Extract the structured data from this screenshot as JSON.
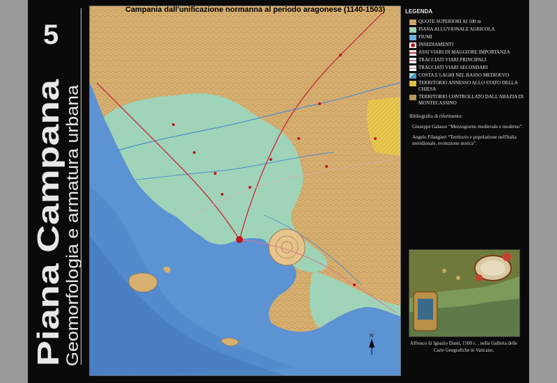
{
  "series_number": "5",
  "series_title": "Piana Campana",
  "series_subtitle": "Geomorfologia e armatura urbana",
  "map": {
    "title": "Campania dall'unificazione normanna al periodo aragonese (1140-1503)",
    "north_label": "N"
  },
  "legend": {
    "title": "LEGENDA",
    "items": [
      {
        "label": "QUOTE SUPERIORI AI 100 m",
        "color": "#d8b070",
        "icon": "hatched-swatch"
      },
      {
        "label": "PIANA ALLUVIONALE AGRICOLA",
        "color": "#9fd4b8",
        "icon": "solid-swatch"
      },
      {
        "label": "FIUMI",
        "color": "#6aaee0",
        "icon": "river-swatch"
      },
      {
        "label": "INSEDIAMENTI",
        "color": "#c0141c",
        "icon": "settlement-marker"
      },
      {
        "label": "ASSI VIARI DI MAGGIORE IMPORTANZA",
        "color": "#c83040",
        "icon": "road-major"
      },
      {
        "label": "TRACCIATI VIARI PRINCIPALI",
        "color": "#d87890",
        "icon": "road-main"
      },
      {
        "label": "TRACCIATI VIARI SECONDARI",
        "color": "#e0a8b8",
        "icon": "road-secondary"
      },
      {
        "label": "COSTA E LAGHI NEL BASSO MEDIOEVO",
        "color": "#3a8cc8",
        "icon": "coast-swatch"
      },
      {
        "label": "TERRITORIO ANNESSO ALLO STATO DELLA CHIESA",
        "color": "#e8c850",
        "icon": "hatched-yellow"
      },
      {
        "label": "TERRITORIO CONTROLLATO DALL'ABAZIA DI MONTECASSINO",
        "color": "#c8a860",
        "icon": "hatched-brown"
      }
    ]
  },
  "bibliography": {
    "heading": "Bibliografia di riferimento:",
    "refs": [
      {
        "author": "Giuseppe Galasso",
        "title": "“Mezzogiorno medievale e moderno”."
      },
      {
        "author": "Angelo Filangieri",
        "title": "“Territorio e popolazione nell'Italia meridionale, evoluzione storica”."
      }
    ]
  },
  "fresco_caption": "Affresco di Ignazio Danti, 1500 c. , nella Galleria delle Carte Geografiche in Vaticano.",
  "colors": {
    "sea": "#5b93d3",
    "plain": "#9fd4b8",
    "hills": "#d8b070",
    "papal": "#e8c850",
    "settlement": "#c0141c"
  }
}
